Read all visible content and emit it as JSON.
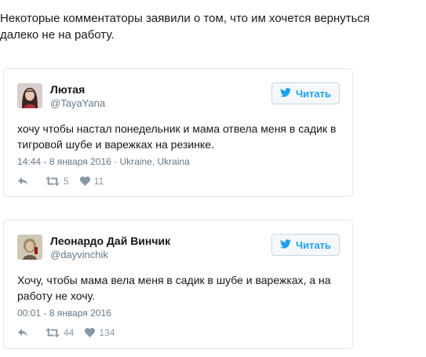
{
  "intro": "Некоторые комментаторы заявили о том, что им хочется вернуться далеко не на работу.",
  "tweets": [
    {
      "name": "Лютая",
      "handle": "@TayaYana",
      "follow_label": "Читать",
      "text": "хочу чтобы настал понедельник и мама отвела меня в садик в тигровой шубе и варежках на резинке.",
      "meta": "14:44 - 8 января 2016 · Ukraine, Ukraina",
      "retweets": "5",
      "likes": "11"
    },
    {
      "name": "Леонардо Дай Винчик",
      "handle": "@dayvinchik",
      "follow_label": "Читать",
      "text": "Хочу, чтобы мама вела меня в садик в шубе и варежках, а на работу не хочу.",
      "meta": "00:01 - 8 января 2016",
      "retweets": "44",
      "likes": "134"
    }
  ],
  "icons": {
    "follow": "bird-icon",
    "reply": "reply-icon",
    "retweet": "retweet-icon",
    "like": "heart-icon"
  },
  "colors": {
    "accent": "#1da1f2",
    "muted": "#657786",
    "icon": "#8899a6"
  }
}
